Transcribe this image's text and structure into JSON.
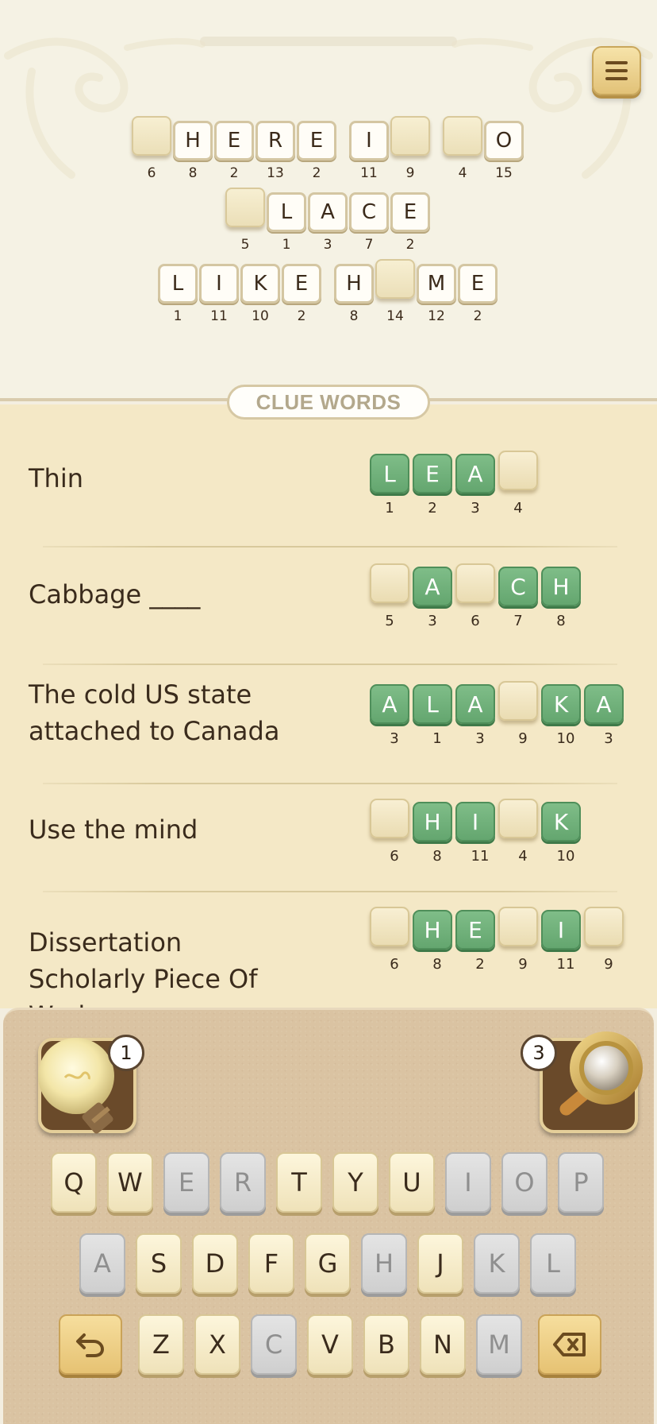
{
  "menu": {
    "icon": "hamburger-icon"
  },
  "phrase": {
    "lines": [
      [
        {
          "letter": "",
          "number": "6"
        },
        {
          "letter": "H",
          "number": "8"
        },
        {
          "letter": "E",
          "number": "2"
        },
        {
          "letter": "R",
          "number": "13"
        },
        {
          "letter": "E",
          "number": "2"
        },
        null,
        {
          "letter": "I",
          "number": "11"
        },
        {
          "letter": "",
          "number": "9"
        },
        null,
        {
          "letter": "",
          "number": "4"
        },
        {
          "letter": "O",
          "number": "15"
        }
      ],
      [
        {
          "letter": "",
          "number": "5"
        },
        {
          "letter": "L",
          "number": "1"
        },
        {
          "letter": "A",
          "number": "3"
        },
        {
          "letter": "C",
          "number": "7"
        },
        {
          "letter": "E",
          "number": "2"
        }
      ],
      [
        {
          "letter": "L",
          "number": "1"
        },
        {
          "letter": "I",
          "number": "11"
        },
        {
          "letter": "K",
          "number": "10"
        },
        {
          "letter": "E",
          "number": "2"
        },
        null,
        {
          "letter": "H",
          "number": "8"
        },
        {
          "letter": "",
          "number": "14"
        },
        {
          "letter": "M",
          "number": "12"
        },
        {
          "letter": "E",
          "number": "2"
        }
      ]
    ]
  },
  "clue_header": "CLUE WORDS",
  "clues": [
    {
      "text": "Thin",
      "tiles": [
        {
          "letter": "L",
          "number": "1"
        },
        {
          "letter": "E",
          "number": "2"
        },
        {
          "letter": "A",
          "number": "3"
        },
        {
          "letter": "",
          "number": "4"
        }
      ]
    },
    {
      "text": "Cabbage ____",
      "tiles": [
        {
          "letter": "",
          "number": "5"
        },
        {
          "letter": "A",
          "number": "3"
        },
        {
          "letter": "",
          "number": "6"
        },
        {
          "letter": "C",
          "number": "7"
        },
        {
          "letter": "H",
          "number": "8"
        }
      ]
    },
    {
      "text": "The cold US state attached to Canada",
      "tiles": [
        {
          "letter": "A",
          "number": "3"
        },
        {
          "letter": "L",
          "number": "1"
        },
        {
          "letter": "A",
          "number": "3"
        },
        {
          "letter": "",
          "number": "9"
        },
        {
          "letter": "K",
          "number": "10"
        },
        {
          "letter": "A",
          "number": "3"
        }
      ]
    },
    {
      "text": "Use the mind",
      "tiles": [
        {
          "letter": "",
          "number": "6"
        },
        {
          "letter": "H",
          "number": "8"
        },
        {
          "letter": "I",
          "number": "11"
        },
        {
          "letter": "",
          "number": "4"
        },
        {
          "letter": "K",
          "number": "10"
        }
      ]
    },
    {
      "text": "Dissertation Scholarly Piece Of Work",
      "tiles": [
        {
          "letter": "",
          "number": "6"
        },
        {
          "letter": "H",
          "number": "8"
        },
        {
          "letter": "E",
          "number": "2"
        },
        {
          "letter": "",
          "number": "9"
        },
        {
          "letter": "I",
          "number": "11"
        },
        {
          "letter": "",
          "number": "9"
        }
      ]
    }
  ],
  "powerups": {
    "hint": {
      "icon": "lightbulb-icon",
      "count": "1"
    },
    "magnifier": {
      "icon": "magnifying-glass-icon",
      "count": "3"
    }
  },
  "keyboard": {
    "rows": [
      [
        {
          "key": "Q",
          "used": false
        },
        {
          "key": "W",
          "used": false
        },
        {
          "key": "E",
          "used": true
        },
        {
          "key": "R",
          "used": true
        },
        {
          "key": "T",
          "used": false
        },
        {
          "key": "Y",
          "used": false
        },
        {
          "key": "U",
          "used": false
        },
        {
          "key": "I",
          "used": true
        },
        {
          "key": "O",
          "used": true
        },
        {
          "key": "P",
          "used": true
        }
      ],
      [
        {
          "key": "A",
          "used": true
        },
        {
          "key": "S",
          "used": false
        },
        {
          "key": "D",
          "used": false
        },
        {
          "key": "F",
          "used": false
        },
        {
          "key": "G",
          "used": false
        },
        {
          "key": "H",
          "used": true
        },
        {
          "key": "J",
          "used": false
        },
        {
          "key": "K",
          "used": true
        },
        {
          "key": "L",
          "used": true
        }
      ],
      [
        {
          "key": "Z",
          "used": false
        },
        {
          "key": "X",
          "used": false
        },
        {
          "key": "C",
          "used": true
        },
        {
          "key": "V",
          "used": false
        },
        {
          "key": "B",
          "used": false
        },
        {
          "key": "N",
          "used": false
        },
        {
          "key": "M",
          "used": true
        }
      ]
    ],
    "undo": {
      "icon": "undo-arrow-icon"
    },
    "backspace": {
      "icon": "backspace-icon"
    }
  },
  "colors": {
    "correct_tile": "#6aac75",
    "used_key": "#d3d3d3",
    "active_key": "#f7edcb",
    "panel": "#dac3a2"
  }
}
